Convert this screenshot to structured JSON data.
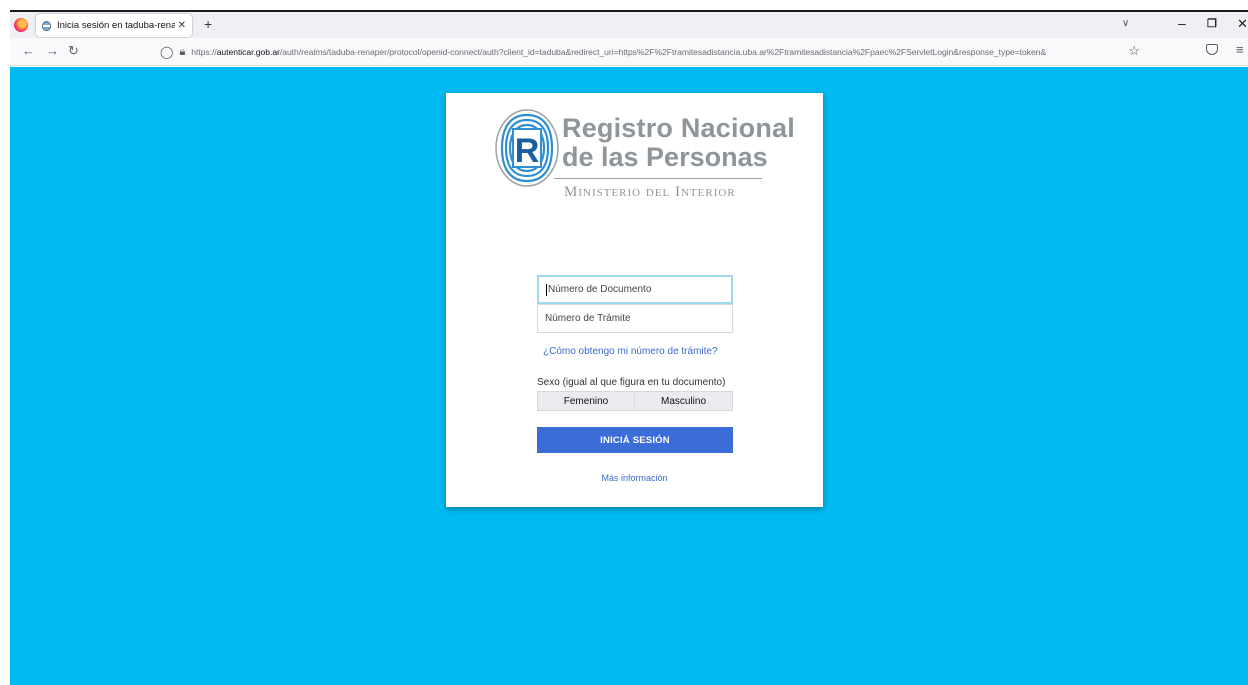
{
  "browser": {
    "tab_title": "Inicia sesión en taduba-renaper",
    "tab_close": "✕",
    "new_tab": "+",
    "url_scheme": "https://",
    "url_domain": "autenticar.gob.ar",
    "url_path": "/auth/realms/taduba-renaper/protocol/openid-connect/auth?client_id=taduba&redirect_uri=https%2F%2Ftramitesadistancia.uba.ar%2Ftramitesadistancia%2Fpaec%2FServletLogin&response_type=token&"
  },
  "logo": {
    "line1": "Registro Nacional",
    "line2": "de las Personas",
    "ministry": "Ministerio del Interior",
    "emblem_letter": "R"
  },
  "form": {
    "document_placeholder": "Número de Documento",
    "tramite_placeholder": "Número de Trámite",
    "help_link": "¿Cómo obtengo mi número de trámite?",
    "sex_label": "Sexo (igual al que figura en tu documento)",
    "sex_options": [
      "Femenino",
      "Masculino"
    ],
    "submit_label": "INICIÁ SESIÓN",
    "more_info": "Más información"
  },
  "colors": {
    "page_background": "#00bbf2",
    "button": "#3b6cd7",
    "link": "#3a69c7",
    "logo_gray": "#8e969c",
    "emblem_blue": "#2f8fd0"
  }
}
